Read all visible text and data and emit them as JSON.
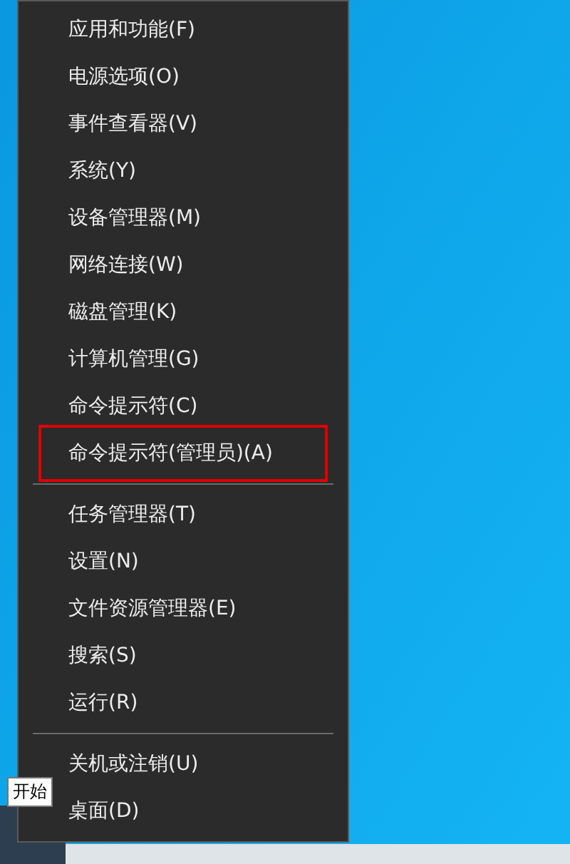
{
  "menu": {
    "groups": [
      {
        "items": [
          {
            "label": "应用和功能(F)",
            "highlighted": false
          },
          {
            "label": "电源选项(O)",
            "highlighted": false
          },
          {
            "label": "事件查看器(V)",
            "highlighted": false
          },
          {
            "label": "系统(Y)",
            "highlighted": false
          },
          {
            "label": "设备管理器(M)",
            "highlighted": false
          },
          {
            "label": "网络连接(W)",
            "highlighted": false
          },
          {
            "label": "磁盘管理(K)",
            "highlighted": false
          },
          {
            "label": "计算机管理(G)",
            "highlighted": false
          },
          {
            "label": "命令提示符(C)",
            "highlighted": false
          },
          {
            "label": "命令提示符(管理员)(A)",
            "highlighted": true
          }
        ]
      },
      {
        "items": [
          {
            "label": "任务管理器(T)",
            "highlighted": false
          },
          {
            "label": "设置(N)",
            "highlighted": false
          },
          {
            "label": "文件资源管理器(E)",
            "highlighted": false
          },
          {
            "label": "搜索(S)",
            "highlighted": false
          },
          {
            "label": "运行(R)",
            "highlighted": false
          }
        ]
      },
      {
        "items": [
          {
            "label": "关机或注销(U)",
            "highlighted": false
          },
          {
            "label": "桌面(D)",
            "highlighted": false
          }
        ]
      }
    ]
  },
  "tooltip": {
    "text": "开始"
  }
}
